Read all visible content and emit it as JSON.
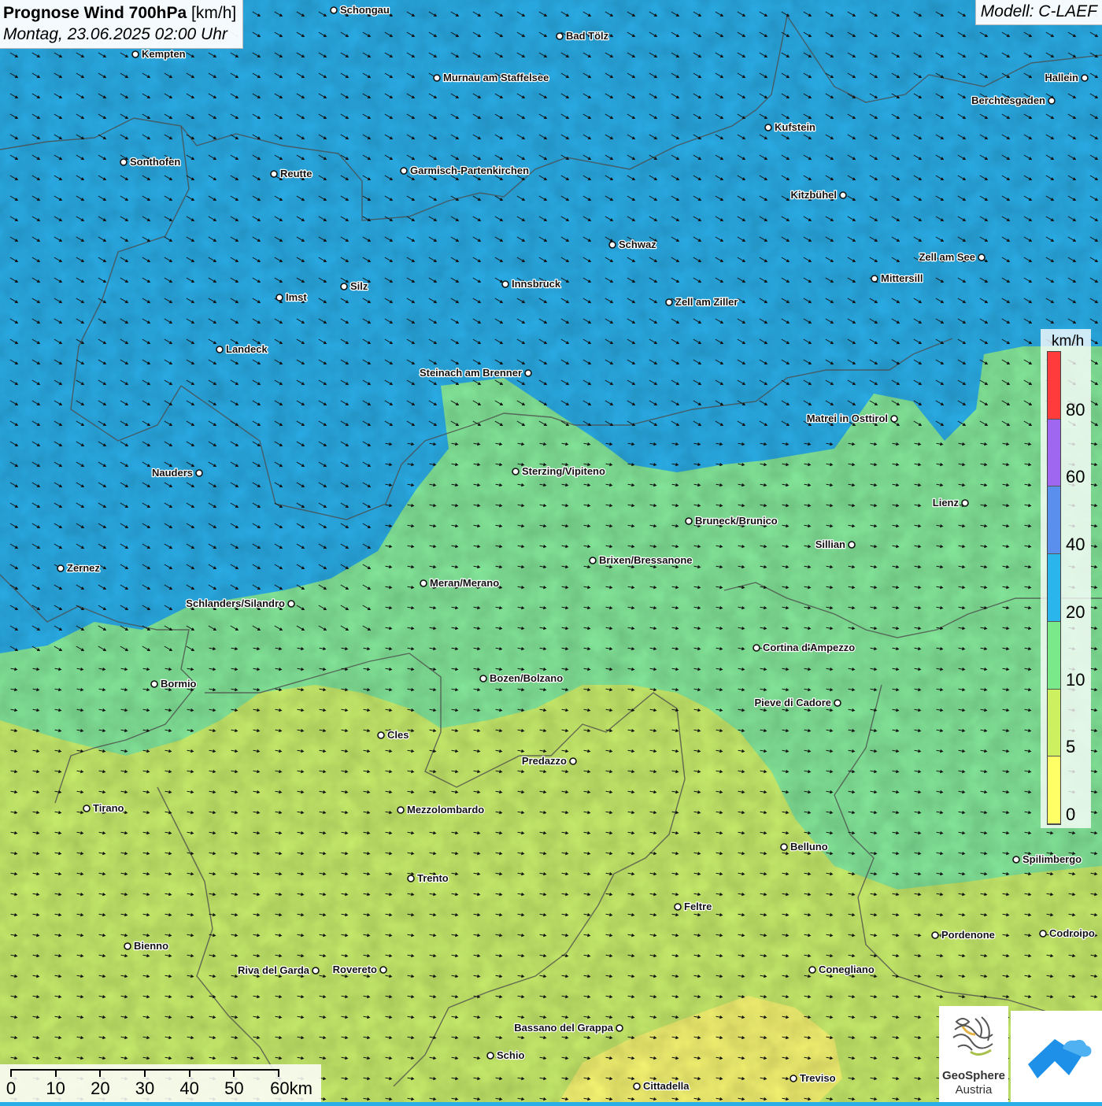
{
  "title": {
    "main": "Prognose Wind 700hPa",
    "unit": "[km/h]",
    "datetime": "Montag, 23.06.2025 02:00 Uhr"
  },
  "model": "Modell: C-LAEF",
  "legend": {
    "unit": "km/h",
    "labels": [
      "80",
      "60",
      "40",
      "20",
      "10",
      "5",
      "0"
    ],
    "colors": [
      "#ff3b3b",
      "#9f66f0",
      "#5a8fee",
      "#2ab6ec",
      "#79e98a",
      "#cdf060",
      "#ffff66"
    ]
  },
  "scale": {
    "labels": [
      "0",
      "10",
      "20",
      "30",
      "40",
      "50",
      "60km"
    ]
  },
  "logo": {
    "name": "GeoSphere",
    "sub": "Austria"
  },
  "colors": {
    "blue_zone": "#2aaee8",
    "green_zone": "#84e89a",
    "yellow_green_zone": "#c9ee6c",
    "yellow_zone": "#f6f572"
  },
  "cities": [
    {
      "name": "Schongau"
    },
    {
      "name": "Bad Tölz"
    },
    {
      "name": "Kempten"
    },
    {
      "name": "Murnau am Staffelsee"
    },
    {
      "name": "Hallein"
    },
    {
      "name": "Berchtesgaden"
    },
    {
      "name": "Kufstein"
    },
    {
      "name": "Sonthofen"
    },
    {
      "name": "Reutte"
    },
    {
      "name": "Garmisch-Partenkirchen"
    },
    {
      "name": "Kitzbühel"
    },
    {
      "name": "Schwaz"
    },
    {
      "name": "Zell am See"
    },
    {
      "name": "Mittersill"
    },
    {
      "name": "Innsbruck"
    },
    {
      "name": "Silz"
    },
    {
      "name": "Imst"
    },
    {
      "name": "Zell am Ziller"
    },
    {
      "name": "Landeck"
    },
    {
      "name": "Steinach am Brenner"
    },
    {
      "name": "Matrei in Osttirol"
    },
    {
      "name": "Nauders"
    },
    {
      "name": "Sterzing/Vipiteno"
    },
    {
      "name": "Lienz"
    },
    {
      "name": "Bruneck/Brunico"
    },
    {
      "name": "Sillian"
    },
    {
      "name": "Brixen/Bressanone"
    },
    {
      "name": "Zernez"
    },
    {
      "name": "Meran/Merano"
    },
    {
      "name": "Schlanders/Silandro"
    },
    {
      "name": "Cortina d'Ampezzo"
    },
    {
      "name": "Bozen/Bolzano"
    },
    {
      "name": "Bormio"
    },
    {
      "name": "Pieve di Cadore"
    },
    {
      "name": "Cles"
    },
    {
      "name": "Predazzo"
    },
    {
      "name": "Tirano"
    },
    {
      "name": "Mezzolombardo"
    },
    {
      "name": "Belluno"
    },
    {
      "name": "Spilimbergo"
    },
    {
      "name": "Trento"
    },
    {
      "name": "Feltre"
    },
    {
      "name": "Pordenone"
    },
    {
      "name": "Codroipo"
    },
    {
      "name": "Bienno"
    },
    {
      "name": "Riva del Garda"
    },
    {
      "name": "Rovereto"
    },
    {
      "name": "Conegliano"
    },
    {
      "name": "Bassano del Grappa"
    },
    {
      "name": "Schio"
    },
    {
      "name": "Treviso"
    },
    {
      "name": "Cittadella"
    }
  ]
}
